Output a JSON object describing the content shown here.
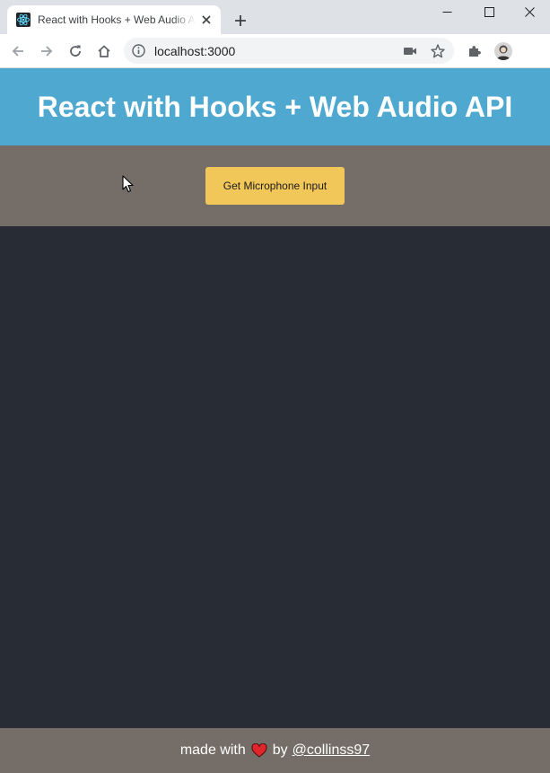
{
  "browser": {
    "tab_title": "React with Hooks + Web Audio API",
    "new_tab_icon": "plus-icon",
    "url": "localhost:3000",
    "window_controls": [
      "minimize",
      "maximize",
      "close"
    ]
  },
  "header": {
    "title": "React with Hooks + Web Audio API"
  },
  "controls": {
    "mic_button_label": "Get Microphone Input"
  },
  "footer": {
    "made_with": "made with",
    "by": "by",
    "author_link": "@collinss97"
  },
  "colors": {
    "header_bg": "#4ea8d0",
    "controls_bg": "#756e68",
    "canvas_bg": "#282c34",
    "button_bg": "#f2c75a",
    "heart": "#e0252b"
  }
}
